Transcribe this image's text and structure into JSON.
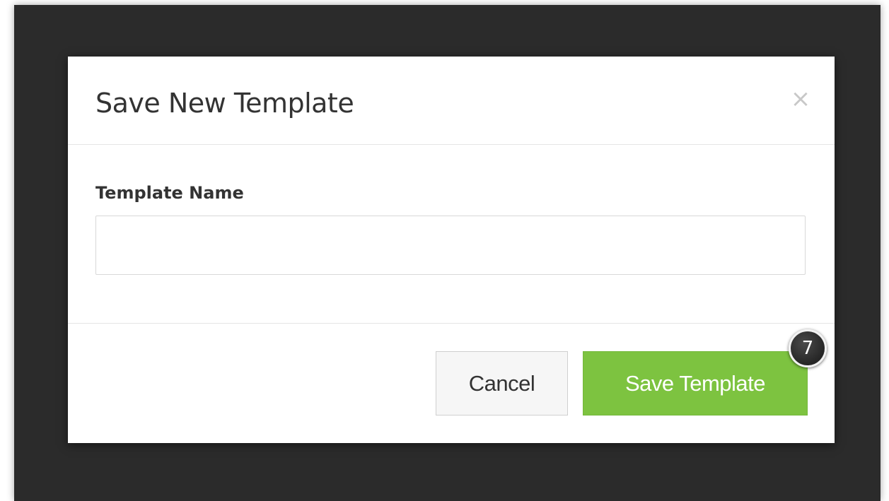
{
  "modal": {
    "title": "Save New Template",
    "close_label": "×",
    "close_icon": "close-icon"
  },
  "form": {
    "field_label": "Template Name",
    "field_value": "",
    "field_placeholder": ""
  },
  "footer": {
    "cancel_label": "Cancel",
    "save_label": "Save Template"
  },
  "annotation": {
    "step_number": "7"
  },
  "colors": {
    "backdrop": "#2b2b2b",
    "primary_button": "#7dc340",
    "cancel_button": "#f6f6f6",
    "close_icon": "#c8c8c8"
  }
}
